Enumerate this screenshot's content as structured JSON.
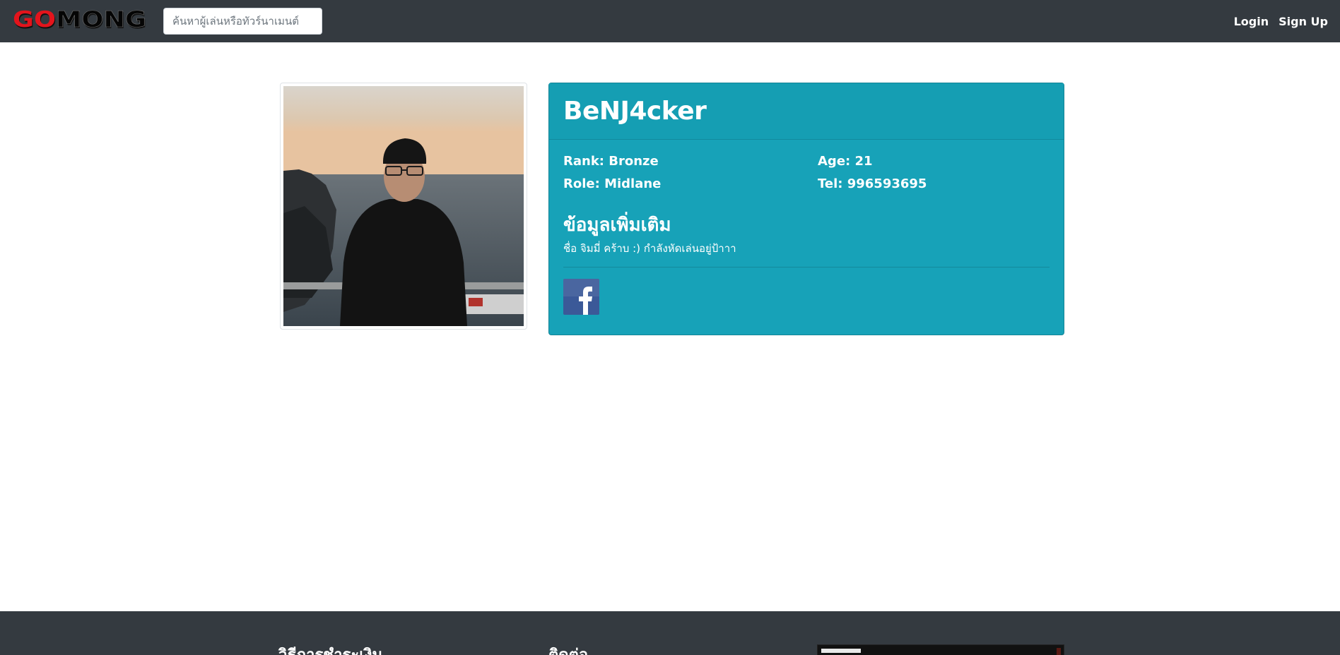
{
  "navbar": {
    "logo_text": "GOMONG",
    "search_placeholder": "ค้นหาผู้เล่นหรือทัวร์นาเมนต์",
    "login_label": "Login",
    "signup_label": "Sign Up"
  },
  "profile": {
    "username": "BeNJ4cker",
    "rank": "Rank: Bronze",
    "age": "Age: 21",
    "role": "Role: Midlane",
    "tel": "Tel: 996593695",
    "more_info_title": "ข้อมูลเพิ่มเติม",
    "about": "ชื่อ จิมมี่ คร้าบ :) กำลังหัดเล่นอยู่ป้าาา",
    "social_icon": "facebook-icon"
  },
  "footer": {
    "col1_heading": "วิธีการชำระเงิน",
    "col2_heading": "ติดต่อ"
  },
  "colors": {
    "navbar_bg": "#343a40",
    "card_bg": "#17a2b8",
    "logo_red": "#e3141c",
    "facebook_blue": "#3b5998"
  }
}
